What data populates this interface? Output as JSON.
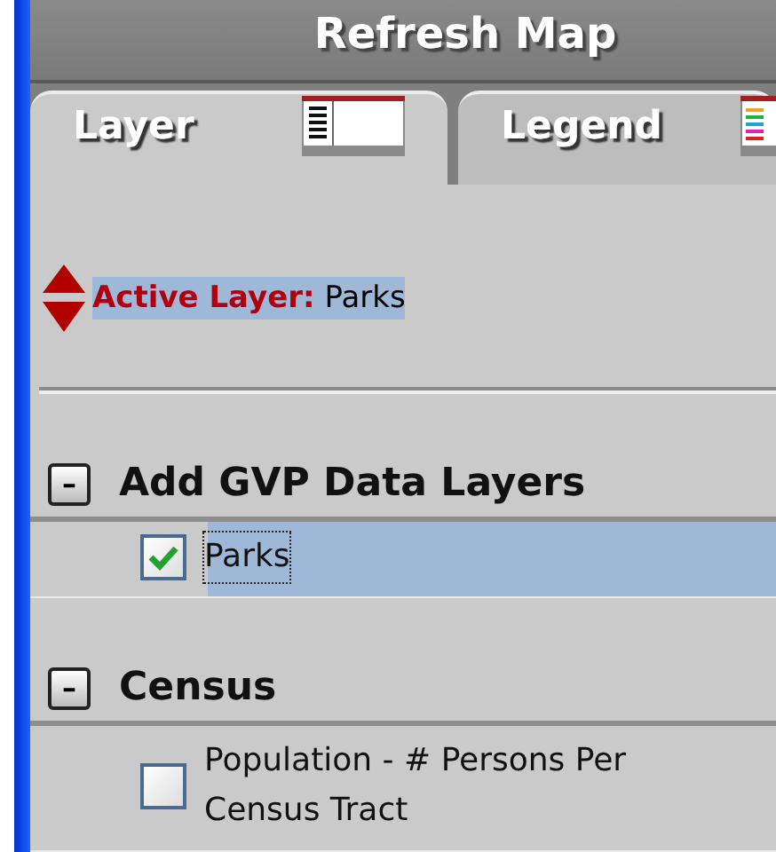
{
  "header": {
    "title": "Refresh Map"
  },
  "tabs": [
    {
      "label": "Layer",
      "selected": true
    },
    {
      "label": "Legend",
      "selected": false
    }
  ],
  "active_layer": {
    "label": "Active Layer:",
    "value": "Parks"
  },
  "groups": [
    {
      "title": "Add GVP Data Layers",
      "toggle": "–",
      "items": [
        {
          "label": "Parks",
          "checked": true,
          "selected": true
        }
      ]
    },
    {
      "title": "Census",
      "toggle": "–",
      "items": [
        {
          "label": "Population - # Persons Per Census Tract",
          "checked": false,
          "selected": false
        }
      ]
    }
  ]
}
